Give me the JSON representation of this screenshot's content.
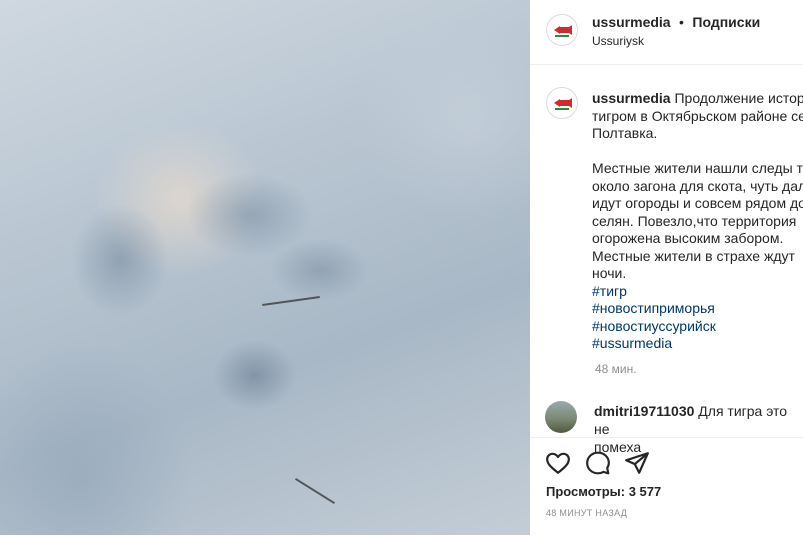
{
  "post": {
    "username": "ussurmedia",
    "follow_label": "Подписки",
    "location": "Ussuriysk",
    "caption_lines": [
      "Продолжение истори",
      "тигром в Октябрьском районе се",
      "Полтавка."
    ],
    "caption_paragraph2": [
      "Местные жители нашли следы ти",
      "около загона для скота, чуть дал",
      "идут огороды и совсем рядом до",
      "селян. Повезло,что территория",
      "огорожена высоким забором.",
      "Местные жители в страхе ждут",
      "ночи."
    ],
    "hashtags": [
      "#тигр",
      "#новостиприморья",
      "#новостиуссурийск",
      "#ussurmedia"
    ],
    "time_ago": "48 мин."
  },
  "comment": {
    "username": "dmitri19711030",
    "text": "Для тигра это не",
    "text_line2": "помеха"
  },
  "stats": {
    "views_label": "Просмотры: 3 577",
    "posted_ago": "48 МИНУТ НАЗАД"
  },
  "colors": {
    "hashtag": "#00376b",
    "muted": "#8e8e8e",
    "text": "#262626"
  },
  "icons": [
    "like-icon",
    "comment-icon",
    "share-icon",
    "logo-icon"
  ]
}
